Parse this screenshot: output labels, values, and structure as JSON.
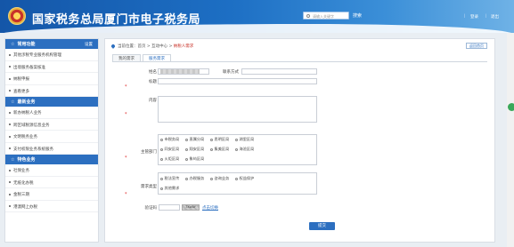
{
  "header": {
    "title": "国家税务总局厦门市电子税务局",
    "search_placeholder": "请输入关键字",
    "search_label": "搜索",
    "login": "登录",
    "logout": "退出"
  },
  "sidebar": {
    "sections": [
      {
        "title": "常用功能",
        "extra": "设置",
        "items": [
          "其他涉税专业服务机构管理",
          "出境服务备案核准",
          "纳税申报",
          "查看更多"
        ]
      },
      {
        "title": "最新业务",
        "items": [
          "新办纳税人业务",
          "跨区域税源信息业务",
          "文明税务业务",
          "支付权限业务系统服务"
        ]
      },
      {
        "title": "特色业务",
        "items": [
          "社保业务",
          "无纸化办税",
          "金税三期",
          "港澳网上办税"
        ]
      }
    ]
  },
  "main": {
    "breadcrumb": {
      "prefix": "当前位置：",
      "home": "首页",
      "sep": " > ",
      "mid": "互动中心",
      "current": "纳税人需求"
    },
    "return_button": "返回首页",
    "tabs": [
      "我的需求",
      "服务需求"
    ],
    "form": {
      "name_label": "姓名",
      "contact_label": "联系方式",
      "title_label": "标题",
      "content_label": "内容",
      "dept_label": "主管部门",
      "dept_options": [
        [
          "市税务局",
          "直属分局",
          "思明区局",
          "湖里区局"
        ],
        [
          "同安区局",
          "翔安区局",
          "集美区局",
          "海沧区局"
        ],
        [
          "火炬区局",
          "象屿区局"
        ]
      ],
      "type_label": "需求类型",
      "type_options": [
        [
          "税法宣传",
          "办税服务",
          "咨询业务",
          "权益保护"
        ],
        [
          "其他需求"
        ]
      ],
      "captcha_label": "验证码",
      "captcha_text": "7XwAY",
      "refresh_link": "点击切换",
      "submit": "提交"
    }
  }
}
